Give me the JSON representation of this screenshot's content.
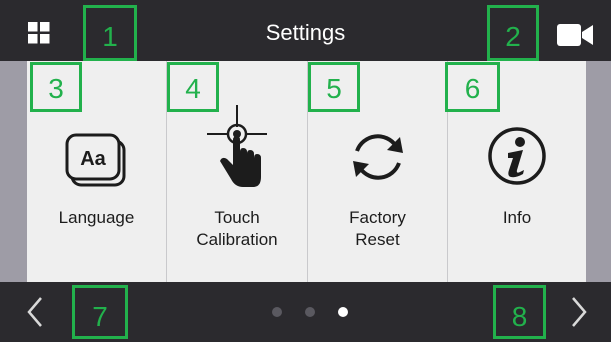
{
  "header": {
    "title": "Settings",
    "left_icon": "grid-icon",
    "right_icon": "video-camera-icon"
  },
  "tiles": [
    {
      "label": "Language",
      "icon": "language-aa-icon"
    },
    {
      "label": "Touch\nCalibration",
      "icon": "touch-calibration-icon"
    },
    {
      "label": "Factory\nReset",
      "icon": "factory-reset-icon"
    },
    {
      "label": "Info",
      "icon": "info-icon"
    }
  ],
  "footer": {
    "prev_icon": "chevron-left-icon",
    "next_icon": "chevron-right-icon",
    "pages": 3,
    "current_page": 3
  },
  "annotations": [
    "1",
    "2",
    "3",
    "4",
    "5",
    "6",
    "7",
    "8"
  ],
  "colors": {
    "bar": "#2b2a2e",
    "tile": "#efefef",
    "panel_edge": "#9e9ca6",
    "annotation": "#22b14c",
    "dot_inactive": "#5a5960",
    "dot_active": "#ffffff"
  }
}
